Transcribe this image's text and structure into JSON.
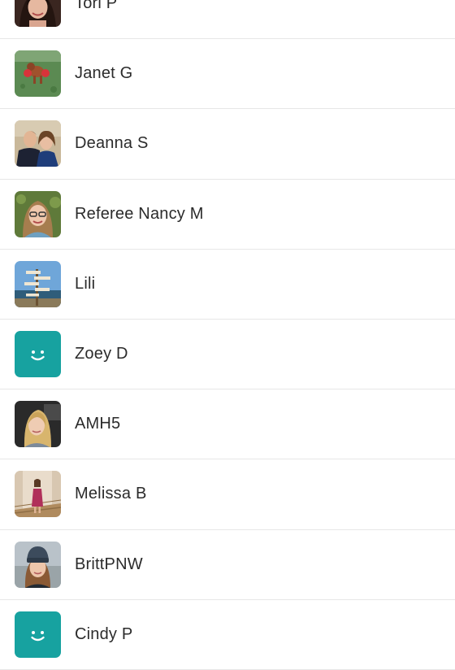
{
  "members": [
    {
      "name": "Tori P",
      "avatar": "photo-brunette-portrait-icon"
    },
    {
      "name": "Janet G",
      "avatar": "photo-dog-on-grass-icon"
    },
    {
      "name": "Deanna S",
      "avatar": "photo-couple-icon"
    },
    {
      "name": "Referee Nancy M",
      "avatar": "photo-woman-glasses-icon"
    },
    {
      "name": "Lili",
      "avatar": "photo-signpost-icon"
    },
    {
      "name": "Zoey D",
      "avatar": "default-smiley-avatar-icon"
    },
    {
      "name": "AMH5",
      "avatar": "photo-blonde-in-car-icon"
    },
    {
      "name": "Melissa B",
      "avatar": "photo-woman-on-stairs-icon"
    },
    {
      "name": "BrittPNW",
      "avatar": "photo-woman-beanie-icon"
    },
    {
      "name": "Cindy P",
      "avatar": "default-smiley-avatar-icon"
    }
  ],
  "colors": {
    "default_avatar": "#17a2a0",
    "divider": "#e7e7e7",
    "text": "#2b2b2b"
  }
}
